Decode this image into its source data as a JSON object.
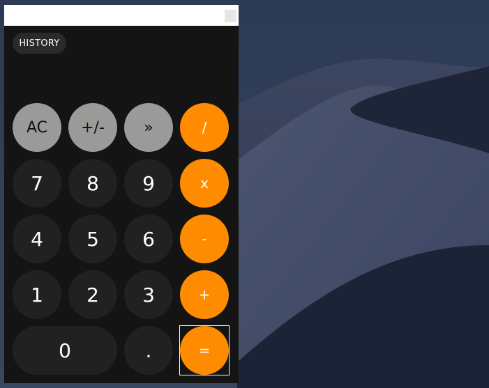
{
  "window": {
    "title": "",
    "accent_color": "#ff8b00"
  },
  "history_label": "HISTORY",
  "display_value": "",
  "keys": {
    "ac": "AC",
    "sign": "+/-",
    "backspace": "»",
    "divide": "/",
    "seven": "7",
    "eight": "8",
    "nine": "9",
    "multiply": "x",
    "four": "4",
    "five": "5",
    "six": "6",
    "minus": "-",
    "one": "1",
    "two": "2",
    "three": "3",
    "plus": "+",
    "zero": "0",
    "decimal": ".",
    "equals": "="
  }
}
